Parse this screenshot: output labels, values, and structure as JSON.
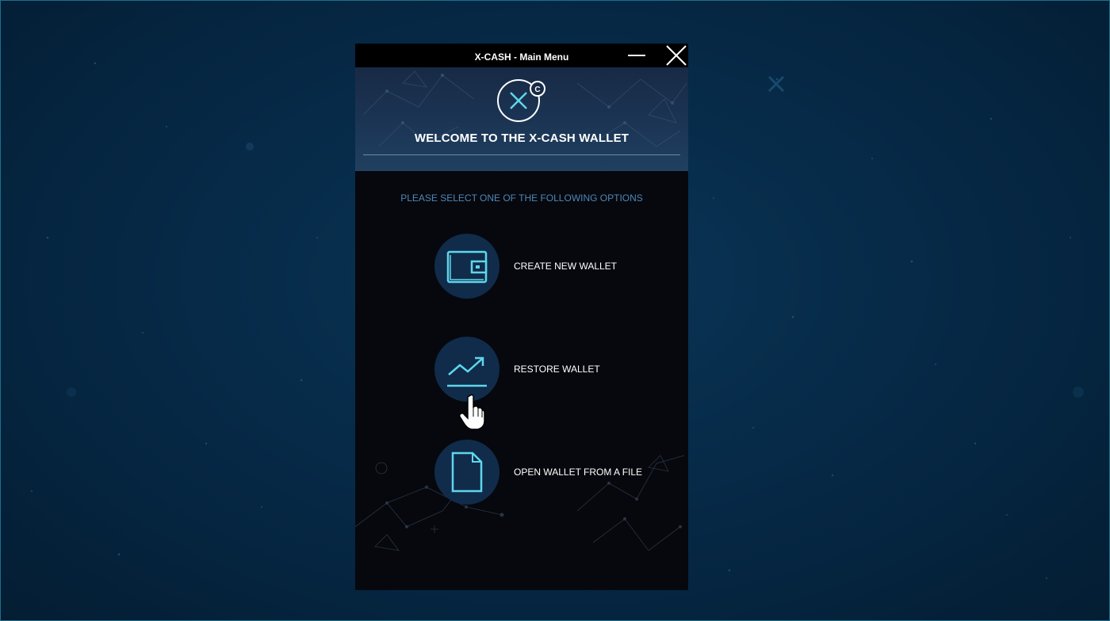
{
  "window": {
    "title": "X-CASH - Main Menu"
  },
  "header": {
    "welcome": "WELCOME TO THE X-CASH WALLET",
    "logo_icon": "x-cash-logo-icon"
  },
  "main": {
    "subtitle": "PLEASE SELECT ONE OF THE FOLLOWING OPTIONS",
    "options": [
      {
        "label": "CREATE NEW WALLET",
        "icon": "wallet-icon"
      },
      {
        "label": "RESTORE WALLET",
        "icon": "trend-up-icon"
      },
      {
        "label": "OPEN WALLET FROM A FILE",
        "icon": "file-icon"
      }
    ]
  },
  "colors": {
    "accent": "#5fd6ec",
    "circle_bg": "#102c4a",
    "subtitle": "#4f87b7",
    "window_bg": "#06080e"
  }
}
